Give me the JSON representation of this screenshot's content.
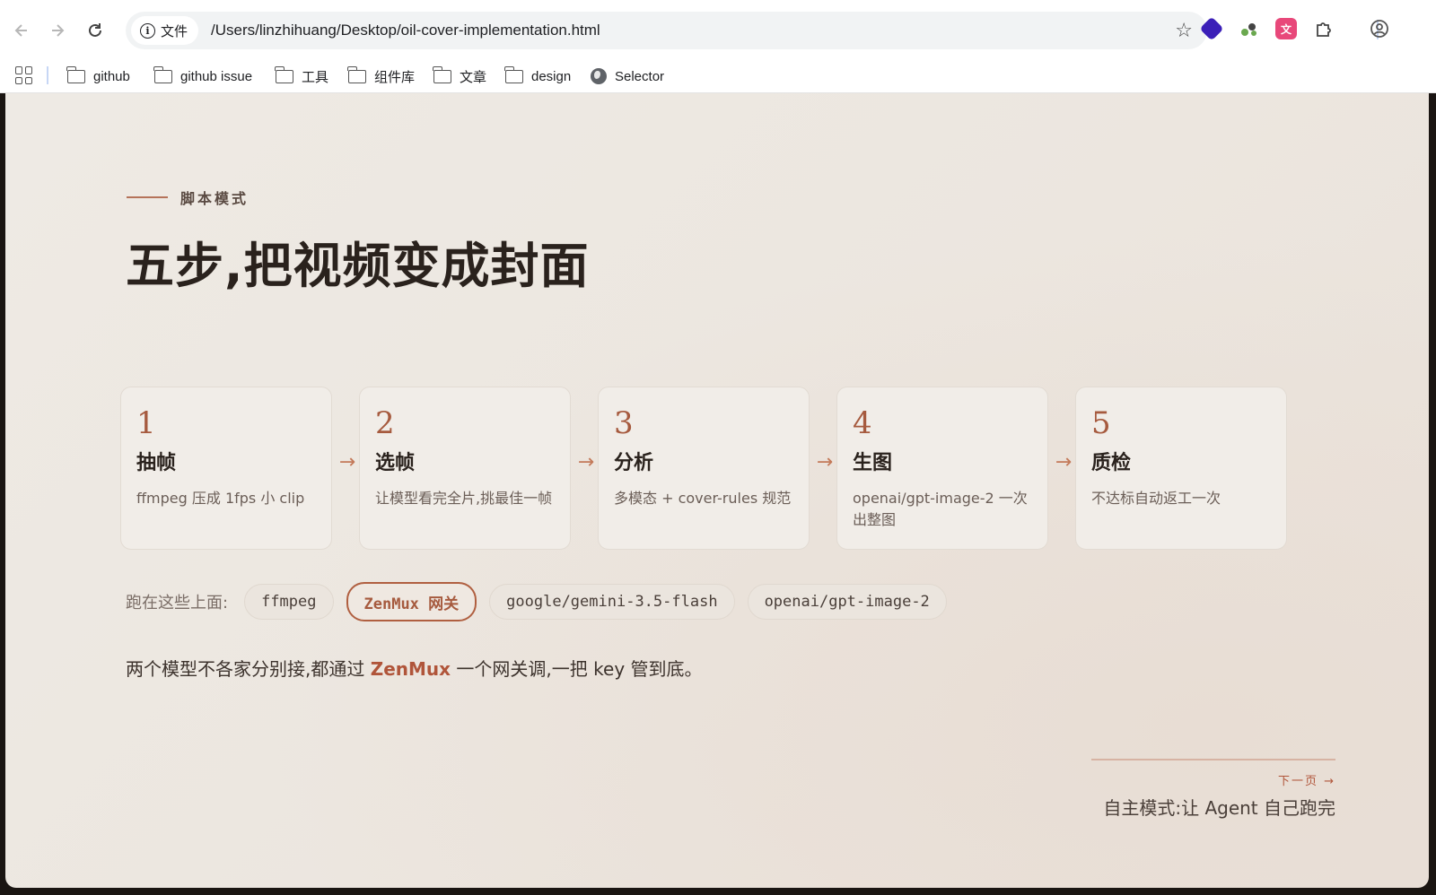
{
  "browser": {
    "site_chip_label": "文件",
    "url": "/Users/linzhihuang/Desktop/oil-cover-implementation.html",
    "bookmarks": [
      {
        "label": "github",
        "icon": "folder-icon"
      },
      {
        "label": "github issue",
        "icon": "folder-icon"
      },
      {
        "label": "工具",
        "icon": "folder-icon"
      },
      {
        "label": "组件库",
        "icon": "folder-icon"
      },
      {
        "label": "文章",
        "icon": "folder-icon"
      },
      {
        "label": "design",
        "icon": "folder-icon"
      },
      {
        "label": "Selector",
        "icon": "globe-icon"
      }
    ],
    "extensions": [
      {
        "name": "diamond-extension-icon",
        "color": "#3b1fb8"
      },
      {
        "name": "puzzle-green-extension-icon",
        "color": "#6aa84f"
      },
      {
        "name": "translate-extension-icon",
        "color": "#e8487a"
      }
    ]
  },
  "slide": {
    "eyebrow": "脚本模式",
    "title": "五步,把视频变成封面",
    "steps": [
      {
        "num": "1",
        "title": "抽帧",
        "desc": "ffmpeg 压成 1fps 小 clip"
      },
      {
        "num": "2",
        "title": "选帧",
        "desc": "让模型看完全片,挑最佳一帧"
      },
      {
        "num": "3",
        "title": "分析",
        "desc": "多模态 + cover-rules 规范"
      },
      {
        "num": "4",
        "title": "生图",
        "desc": "openai/gpt-image-2 一次出整图"
      },
      {
        "num": "5",
        "title": "质检",
        "desc": "不达标自动返工一次"
      }
    ],
    "arrow_glyph": "→",
    "tech_label": "跑在这些上面:",
    "tech": [
      "ffmpeg",
      "ZenMux 网关",
      "google/gemini-3.5-flash",
      "openai/gpt-image-2"
    ],
    "summary_before": "两个模型不各家分别接,都通过 ",
    "summary_accent": "ZenMux",
    "summary_after": " 一个网关调,一把 key 管到底。",
    "next_hint": "下一页 →",
    "next_title": "自主模式:让 Agent 自己跑完"
  },
  "colors": {
    "accent": "#b0553a",
    "background": "#ece6df",
    "title": "#2a221d"
  }
}
